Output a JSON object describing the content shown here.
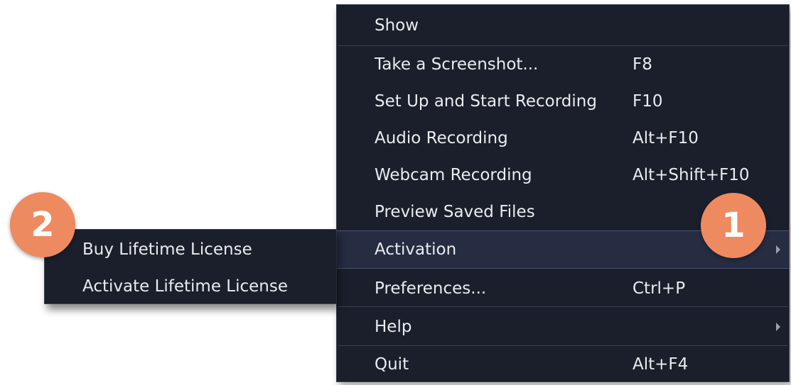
{
  "menu": {
    "items": [
      {
        "label": "Show",
        "shortcut": ""
      },
      {
        "label": "Take a Screenshot...",
        "shortcut": "F8"
      },
      {
        "label": "Set Up and Start Recording",
        "shortcut": "F10"
      },
      {
        "label": "Audio Recording",
        "shortcut": "Alt+F10"
      },
      {
        "label": "Webcam Recording",
        "shortcut": "Alt+Shift+F10"
      },
      {
        "label": "Preview Saved Files",
        "shortcut": ""
      },
      {
        "label": "Activation",
        "shortcut": "",
        "has_submenu": true
      },
      {
        "label": "Preferences...",
        "shortcut": "Ctrl+P"
      },
      {
        "label": "Help",
        "shortcut": "",
        "has_submenu": true
      },
      {
        "label": "Quit",
        "shortcut": "Alt+F4"
      }
    ]
  },
  "submenu": {
    "items": [
      {
        "label": "Buy Lifetime License"
      },
      {
        "label": "Activate Lifetime License"
      }
    ]
  },
  "callouts": {
    "one": "1",
    "two": "2"
  },
  "colors": {
    "menu_bg": "#1b1f2c",
    "highlight_bg": "#262c41",
    "text": "#e9ebf0",
    "callout": "#ee8a5f"
  }
}
